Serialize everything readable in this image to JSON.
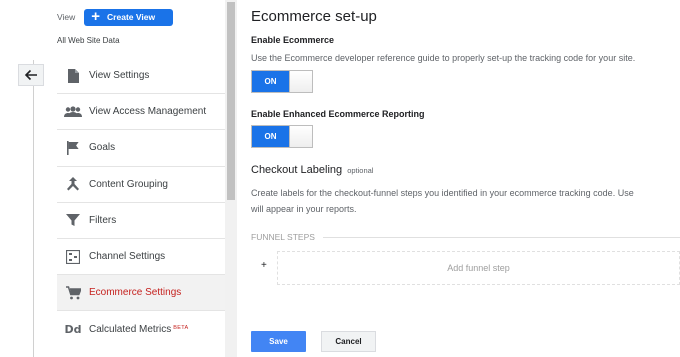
{
  "left_pane": {
    "view_label": "View",
    "create_view_label": "Create View",
    "view_name": "All Web Site Data",
    "nav_items": [
      {
        "label": "View Settings",
        "icon": "document-icon"
      },
      {
        "label": "View Access Management",
        "icon": "people-icon"
      },
      {
        "label": "Goals",
        "icon": "flag-icon"
      },
      {
        "label": "Content Grouping",
        "icon": "grouping-icon"
      },
      {
        "label": "Filters",
        "icon": "filter-icon"
      },
      {
        "label": "Channel Settings",
        "icon": "channel-icon"
      },
      {
        "label": "Ecommerce Settings",
        "icon": "cart-icon",
        "active": true
      },
      {
        "label": "Calculated Metrics",
        "icon": "dd-icon",
        "icon_text": "Dd",
        "badge": "BETA"
      }
    ]
  },
  "main": {
    "title": "Ecommerce set-up",
    "enable_ecommerce": {
      "title": "Enable Ecommerce",
      "description": "Use the Ecommerce developer reference guide to properly set-up the tracking code for your site.",
      "toggle_label": "ON"
    },
    "enhanced_ecommerce": {
      "title": "Enable Enhanced Ecommerce Reporting",
      "toggle_label": "ON"
    },
    "checkout_labeling": {
      "title": "Checkout Labeling",
      "optional": "optional",
      "description_line1": "Create labels for the checkout-funnel steps you identified in your ecommerce tracking code. Use",
      "description_line2": "will appear in your reports."
    },
    "funnel_steps": {
      "header": "FUNNEL STEPS",
      "plus": "+",
      "add_step_label": "Add funnel step"
    },
    "buttons": {
      "save_label": "Save",
      "cancel_label": "Cancel"
    }
  },
  "colors": {
    "primary_blue": "#1a73e8",
    "save_blue": "#4285f4",
    "active_red": "#c5221f"
  }
}
